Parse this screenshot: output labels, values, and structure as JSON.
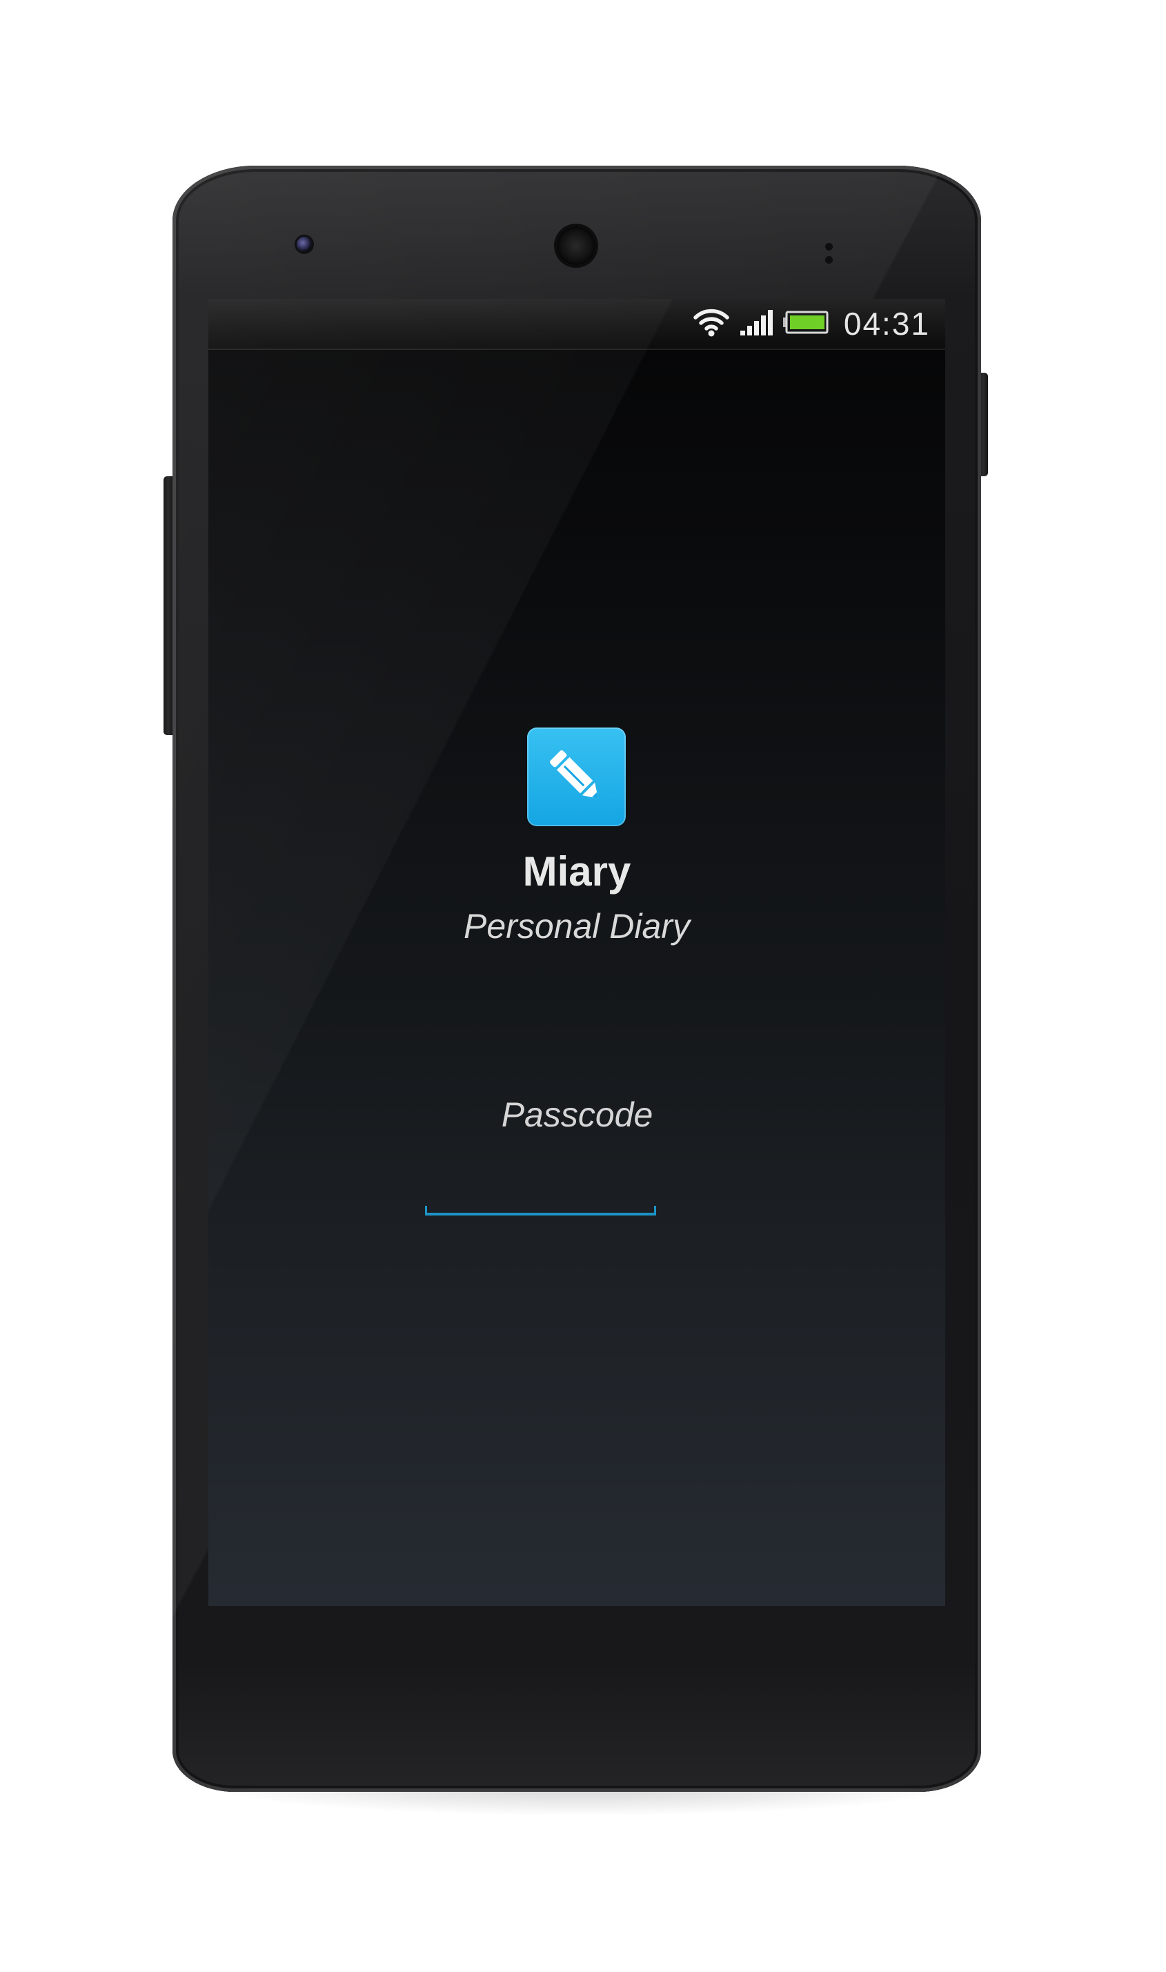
{
  "status_bar": {
    "time": "04:31",
    "icons": [
      "wifi-icon",
      "signal-icon",
      "battery-icon"
    ],
    "battery_color": "#6fcf27"
  },
  "app": {
    "icon": "pencil-edit-icon",
    "icon_color": "#1fb0ea",
    "name": "Miary",
    "tagline": "Personal Diary"
  },
  "login": {
    "passcode_placeholder": "Passcode",
    "passcode_value": "",
    "accent_color": "#1d94c6"
  }
}
